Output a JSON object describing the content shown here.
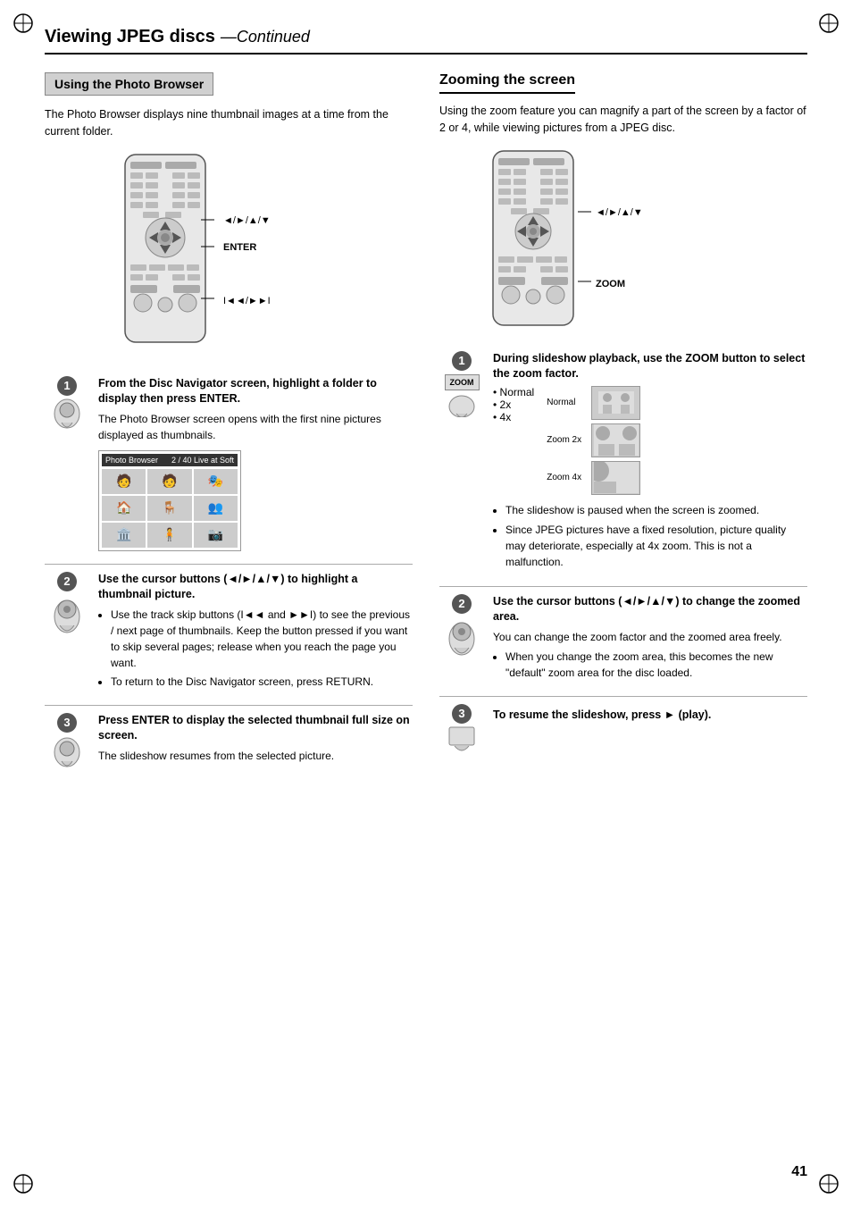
{
  "page": {
    "title": "Viewing JPEG discs",
    "continued": "—Continued",
    "page_number": "41"
  },
  "left_section": {
    "header": "Using the Photo Browser",
    "intro": "The Photo Browser displays nine thumbnail images at a time from the current folder.",
    "steps": [
      {
        "number": "1",
        "title": "From the Disc Navigator screen, highlight a folder to display then press ENTER.",
        "body": "The Photo Browser screen opens with the first nine pictures displayed as thumbnails.",
        "has_thumb": true,
        "thumb_header_left": "Photo Browser",
        "thumb_header_right": "2 / 40   Live at Soft"
      },
      {
        "number": "2",
        "title": "Use the cursor buttons (◄/►/▲/▼) to highlight a thumbnail picture.",
        "bullets": [
          "Use the track skip buttons (I◄◄ and ►►I) to see the previous / next page of thumbnails. Keep the button pressed if you want to skip several pages; release when you reach the page you want.",
          "To return to the Disc Navigator screen, press RETURN."
        ]
      },
      {
        "number": "3",
        "title": "Press ENTER to display the selected thumbnail full size on screen.",
        "body": "The slideshow resumes from the selected picture."
      }
    ],
    "remote_labels": {
      "cursor": "◄/►/▲/▼",
      "enter": "ENTER",
      "skip": "I◄◄/►►I"
    }
  },
  "right_section": {
    "header": "Zooming the screen",
    "intro": "Using the zoom feature you can magnify a part of the screen by a factor of 2 or 4, while viewing pictures from a JPEG disc.",
    "steps": [
      {
        "number": "1",
        "title": "During slideshow playback, use the ZOOM button to select the zoom factor.",
        "zoom_label": "ZOOM",
        "zoom_options": [
          "Normal",
          "2x",
          "4x"
        ],
        "zoom_images": [
          {
            "label": "Normal",
            "scale": 1
          },
          {
            "label": "Zoom 2x",
            "scale": 2
          },
          {
            "label": "Zoom 4x",
            "scale": 4
          }
        ],
        "bullets": [
          "The slideshow is paused when the screen is zoomed.",
          "Since JPEG pictures have a fixed resolution, picture quality may deteriorate, especially at 4x zoom. This is not a malfunction."
        ]
      },
      {
        "number": "2",
        "title": "Use the cursor buttons (◄/►/▲/▼) to change the zoomed area.",
        "body": "You can change the zoom factor and the zoomed area freely.",
        "bullets": [
          "When you change the zoom area, this becomes the new \"default\" zoom area for the disc loaded."
        ]
      },
      {
        "number": "3",
        "title": "To resume the slideshow, press ► (play)."
      }
    ],
    "remote_labels": {
      "cursor": "◄/►/▲/▼",
      "zoom": "ZOOM"
    }
  }
}
